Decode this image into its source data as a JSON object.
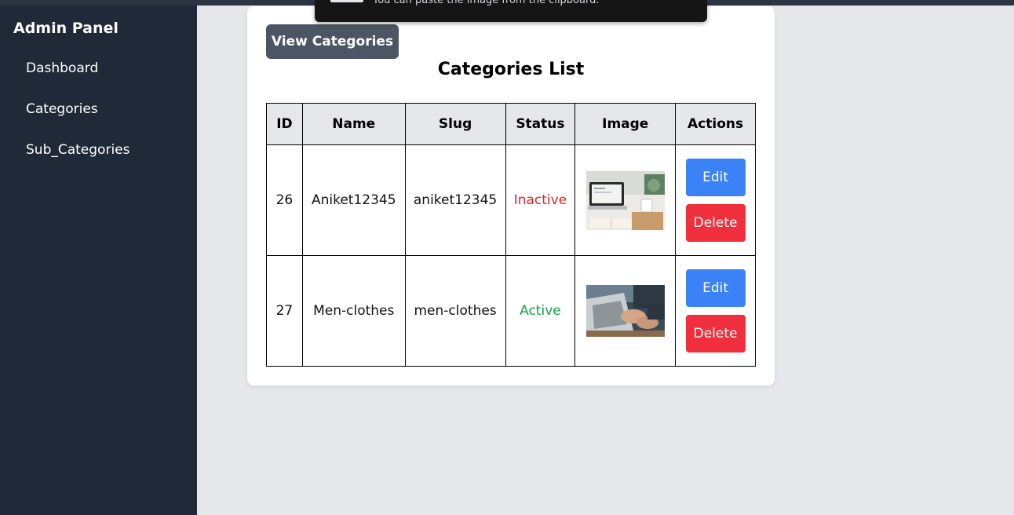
{
  "toast": {
    "message": "You can paste the image from the clipboard."
  },
  "sidebar": {
    "title": "Admin Panel",
    "items": [
      {
        "label": "Dashboard"
      },
      {
        "label": "Categories"
      },
      {
        "label": "Sub_Categories"
      }
    ]
  },
  "main": {
    "view_button_label": "View Categories",
    "list_title": "Categories List",
    "table": {
      "headers": [
        "ID",
        "Name",
        "Slug",
        "Status",
        "Image",
        "Actions"
      ],
      "rows": [
        {
          "id": "26",
          "name": "Aniket12345",
          "slug": "aniket12345",
          "status": "Inactive",
          "image_icon": "laptop-desk-photo",
          "edit_label": "Edit",
          "delete_label": "Delete"
        },
        {
          "id": "27",
          "name": "Men-clothes",
          "slug": "men-clothes",
          "status": "Active",
          "image_icon": "typing-laptop-photo",
          "edit_label": "Edit",
          "delete_label": "Delete"
        }
      ]
    }
  },
  "colors": {
    "sidebar_bg": "#1f2937",
    "page_bg": "#e5e7eb",
    "view_button_bg": "#4b5563",
    "edit_button_bg": "#3b82f6",
    "delete_button_bg": "#ef2f3c",
    "status_inactive": "#dc2626",
    "status_active": "#16a34a"
  }
}
